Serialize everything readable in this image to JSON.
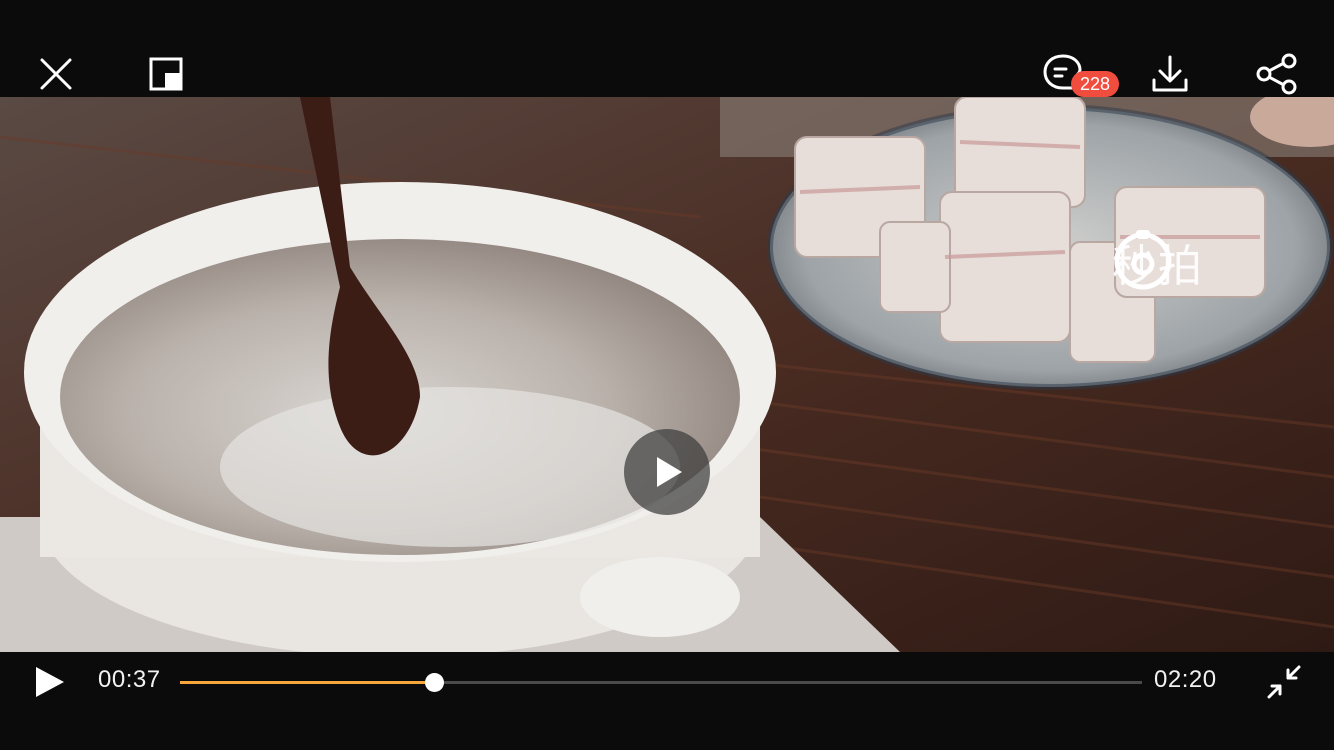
{
  "header": {
    "comment_count": "228",
    "icons": [
      "close-icon",
      "picture-in-picture-icon",
      "comment-icon",
      "download-icon",
      "share-icon"
    ]
  },
  "video": {
    "watermark_text": "秒拍",
    "center_icon": "play-icon"
  },
  "controls": {
    "current_time": "00:37",
    "total_time": "02:20",
    "progress_fraction": 0.264,
    "progress_color": "#f6a63a",
    "icons": [
      "play-icon",
      "exit-fullscreen-icon"
    ]
  }
}
